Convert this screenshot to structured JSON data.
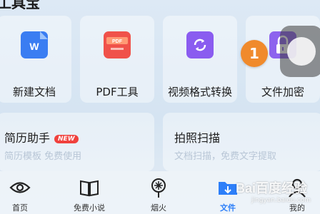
{
  "section": {
    "title": "工具宝"
  },
  "tools": [
    {
      "label": "新建文档",
      "icon": "word-doc-icon",
      "color": "#3a7df2"
    },
    {
      "label": "PDF工具",
      "icon": "pdf-icon",
      "color": "#f0524a"
    },
    {
      "label": "视频格式转换",
      "icon": "video-convert-icon",
      "color": "#8a5cf0"
    },
    {
      "label": "文件加密",
      "icon": "lock-icon",
      "color": "#8d63ee"
    }
  ],
  "features": [
    {
      "title": "简历助手",
      "badge": "NEW",
      "subtitle": "简历模板 免费使用"
    },
    {
      "title": "拍照扫描",
      "subtitle": "文档扫描，免费文字提取"
    }
  ],
  "tabs": [
    {
      "label": "首页",
      "icon": "eye-icon"
    },
    {
      "label": "免费小说",
      "icon": "book-icon"
    },
    {
      "label": "烟火",
      "icon": "firework-icon"
    },
    {
      "label": "文件",
      "icon": "folder-download-icon",
      "active": true
    },
    {
      "label": "我的",
      "icon": "person-icon"
    }
  ],
  "step_marker": "1",
  "watermark": {
    "brand": "Bai百度经验",
    "url": "jingyan.baidu.com"
  },
  "colors": {
    "accent": "#2d7ff9",
    "badge": "#f0413d",
    "marker": "#f08a2c"
  }
}
